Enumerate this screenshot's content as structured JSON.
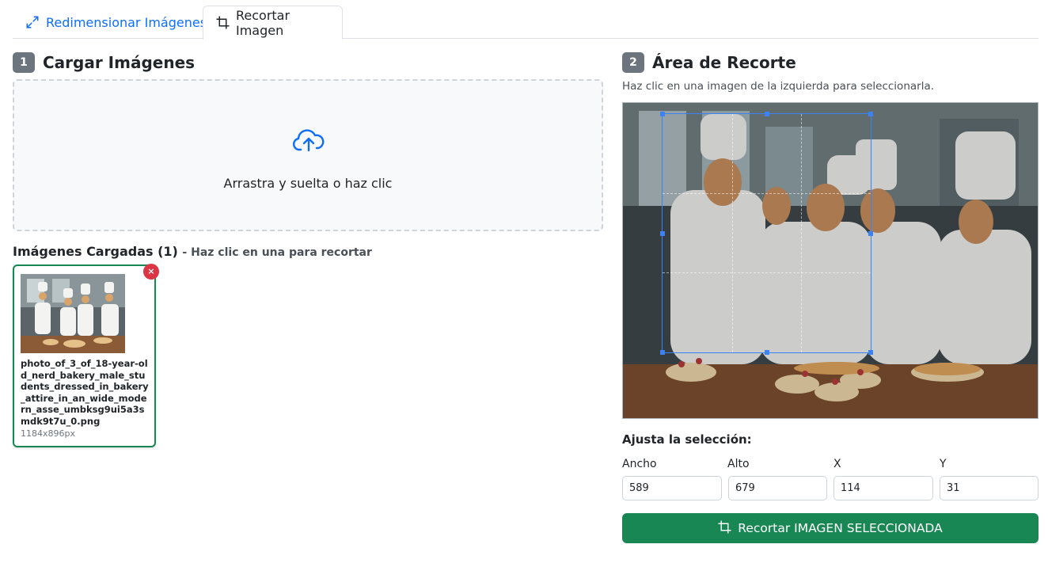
{
  "tabs": [
    {
      "label": "Redimensionar Imágenes",
      "icon": "expand-arrows-icon",
      "active": false
    },
    {
      "label": "Recortar Imagen",
      "icon": "crop-icon",
      "active": true
    }
  ],
  "upload": {
    "step": "1",
    "title": "Cargar Imágenes",
    "dropzone_text": "Arrastra y suelta o haz clic",
    "icon": "cloud-upload-icon"
  },
  "loaded": {
    "title": "Imágenes Cargadas (1)",
    "hint": "- Haz clic en una para recortar",
    "items": [
      {
        "filename": "photo_of_3_of_18-year-old_nerd_bakery_male_students_dressed_in_bakery_attire_in_an_wide_modern_asse_umbksg9ui5a3smdk9t7u_0.png",
        "dimensions": "1184x896px",
        "remove_label": "×"
      }
    ]
  },
  "crop": {
    "step": "2",
    "title": "Área de Recorte",
    "hint": "Haz clic en una imagen de la izquierda para seleccionarla.",
    "adjust_label": "Ajusta la selección:",
    "fields": [
      {
        "label": "Ancho",
        "value": "589"
      },
      {
        "label": "Alto",
        "value": "679"
      },
      {
        "label": "X",
        "value": "114"
      },
      {
        "label": "Y",
        "value": "31"
      }
    ],
    "button_label": "Recortar IMAGEN SELECCIONADA"
  },
  "colors": {
    "primary": "#0d6efd",
    "success": "#198754",
    "danger": "#dc3545",
    "badge": "#6c757d",
    "selection": "#3b82f6"
  }
}
